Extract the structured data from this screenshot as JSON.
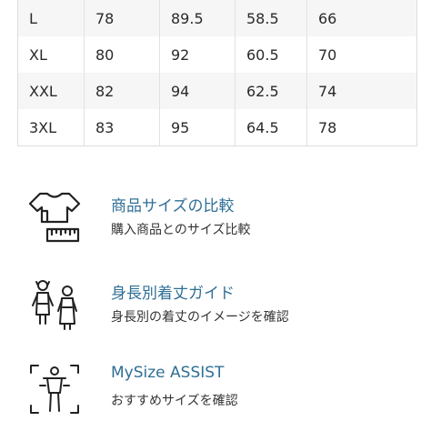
{
  "size_table": {
    "rows": [
      [
        "L",
        "78",
        "89.5",
        "58.5",
        "66"
      ],
      [
        "XL",
        "80",
        "92",
        "60.5",
        "70"
      ],
      [
        "XXL",
        "82",
        "94",
        "62.5",
        "74"
      ],
      [
        "3XL",
        "83",
        "95",
        "64.5",
        "78"
      ]
    ]
  },
  "features": [
    {
      "title": "商品サイズの比較",
      "desc": "購入商品とのサイズ比較",
      "icon": "tshirt-measure-icon"
    },
    {
      "title": "身長別着丈ガイド",
      "desc": "身長別の着丈のイメージを確認",
      "icon": "people-height-icon"
    },
    {
      "title": "MySize ASSIST",
      "desc": "おすすめサイズを確認",
      "icon": "body-scan-icon"
    }
  ]
}
